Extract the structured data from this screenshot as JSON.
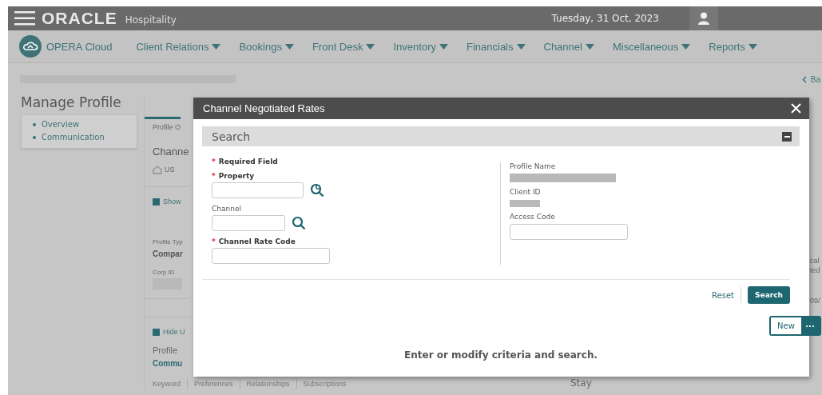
{
  "header": {
    "brand": "ORACLE",
    "product": "Hospitality",
    "date": "Tuesday, 31 Oct, 2023"
  },
  "nav": {
    "app_name": "OPERA Cloud",
    "menus": [
      {
        "label": "Client Relations"
      },
      {
        "label": "Bookings"
      },
      {
        "label": "Front Desk"
      },
      {
        "label": "Inventory"
      },
      {
        "label": "Financials"
      },
      {
        "label": "Channel"
      },
      {
        "label": "Miscellaneous"
      },
      {
        "label": "Reports"
      }
    ]
  },
  "page": {
    "breadcrumb": {
      "redacted": true
    },
    "back_link": "Ba",
    "title": "Manage Profile",
    "side_links": [
      {
        "label": "Overview"
      },
      {
        "label": "Communication"
      }
    ],
    "panel": {
      "tab": "Profile O",
      "name": "Channe",
      "country": "US",
      "show_toggle": "Show",
      "profile_type_label": "Profile Typ",
      "profile_type": "Compar",
      "corp_id_label": "Corp ID",
      "corp_id_redacted": true,
      "hide_toggle": "Hide U",
      "section": "Profile",
      "subsection": "Commu",
      "links": [
        "Keyword",
        "Preferences",
        "Relationships",
        "Subscriptions"
      ]
    },
    "stay_label": "Stay",
    "edge_texts": [
      "cal",
      "ted",
      "09/"
    ]
  },
  "dialog": {
    "title": "Channel Negotiated Rates",
    "panel_title": "Search",
    "expanded": true,
    "required_mark": "*",
    "required_note": "Required Field",
    "left_fields": [
      {
        "label": "Property",
        "required": true,
        "kind": "multi-lookup"
      },
      {
        "label": "Channel",
        "required": false,
        "kind": "lookup"
      },
      {
        "label": "Channel Rate Code",
        "required": true,
        "kind": "plain"
      }
    ],
    "right_fields": [
      {
        "label": "Profile Name",
        "kind": "readonly",
        "redacted": true
      },
      {
        "label": "Client ID",
        "kind": "readonly",
        "redacted": true
      },
      {
        "label": "Access Code",
        "kind": "input"
      }
    ],
    "reset": "Reset",
    "search": "Search",
    "new": "New",
    "more": "•••",
    "message": "Enter or modify criteria and search."
  }
}
